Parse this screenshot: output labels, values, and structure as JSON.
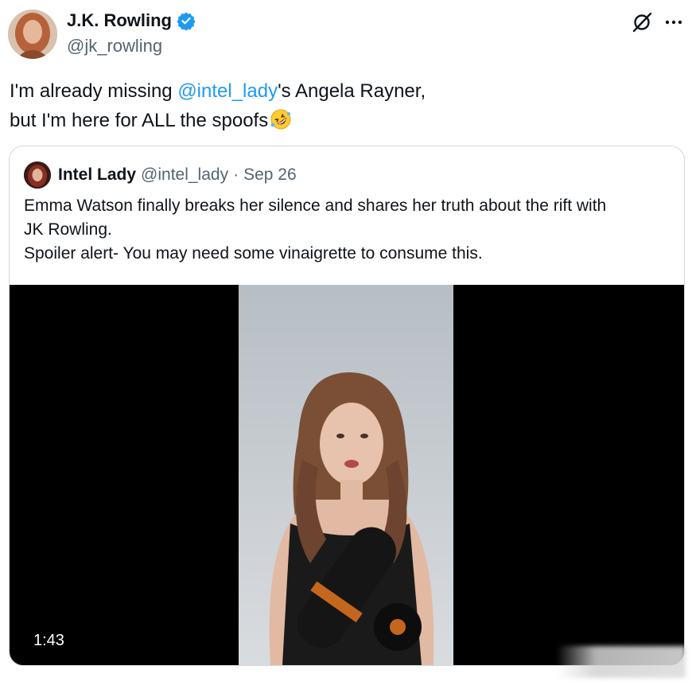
{
  "author": {
    "name": "J.K. Rowling",
    "handle": "@jk_rowling",
    "verified": true,
    "avatar_icon": "avatar-photo"
  },
  "header_icons": [
    "grok-icon",
    "more-options-icon"
  ],
  "tweet": {
    "text_before": "I'm already missing ",
    "mention": "@intel_lady",
    "text_after": "'s Angela Rayner,",
    "line2": "but I'm here for ALL the spoofs",
    "emoji": "rolling-on-floor-laughing-emoji"
  },
  "quoted": {
    "name": "Intel Lady",
    "handle": "@intel_lady",
    "separator": "·",
    "date": "Sep 26",
    "line1": "Emma Watson finally breaks her silence and shares her truth about the rift with",
    "line2": "JK Rowling.",
    "line3": "Spoiler alert- You may need some vinaigrette to consume this.",
    "video": {
      "duration": "1:43"
    }
  },
  "colors": {
    "text": "#0f1419",
    "secondary": "#536471",
    "link": "#1d9bf0",
    "border": "#cfd9de"
  }
}
